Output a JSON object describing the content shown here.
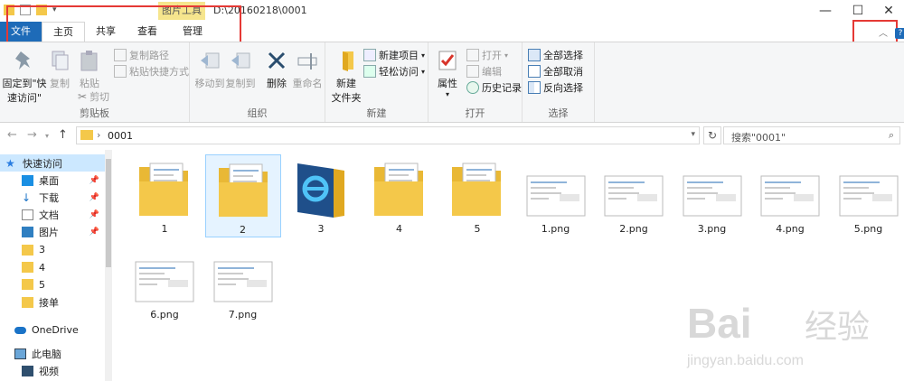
{
  "titlebar": {
    "context_tab": "图片工具",
    "path": "D:\\20160218\\0001",
    "minimize": "—",
    "maximize": "☐",
    "close": "✕"
  },
  "tabs": {
    "file": "文件",
    "home": "主页",
    "share": "共享",
    "view": "查看",
    "manage": "管理"
  },
  "ribbon": {
    "clipboard": {
      "label": "剪贴板",
      "pin_quick_1": "固定到\"快",
      "pin_quick_2": "速访问\"",
      "copy": "复制",
      "paste": "粘贴",
      "copy_path": "复制路径",
      "paste_shortcut": "粘贴快捷方式",
      "cut": "剪切"
    },
    "organize": {
      "label": "组织",
      "move_to": "移动到",
      "copy_to": "复制到",
      "delete": "删除",
      "rename": "重命名"
    },
    "new": {
      "label": "新建",
      "new_folder_1": "新建",
      "new_folder_2": "文件夹",
      "new_item": "新建项目",
      "easy_access": "轻松访问"
    },
    "open": {
      "label": "打开",
      "properties": "属性",
      "open": "打开",
      "edit": "编辑",
      "history": "历史记录"
    },
    "select": {
      "label": "选择",
      "select_all": "全部选择",
      "select_none": "全部取消",
      "invert": "反向选择"
    }
  },
  "address": {
    "path": "0001",
    "search_placeholder": "搜索\"0001\""
  },
  "nav": {
    "quick_access": "快速访问",
    "items": [
      {
        "label": "桌面",
        "pinned": true
      },
      {
        "label": "下载",
        "pinned": true
      },
      {
        "label": "文档",
        "pinned": true
      },
      {
        "label": "图片",
        "pinned": true
      },
      {
        "label": "3",
        "pinned": false
      },
      {
        "label": "4",
        "pinned": false
      },
      {
        "label": "5",
        "pinned": false
      },
      {
        "label": "接单",
        "pinned": false
      }
    ],
    "onedrive": "OneDrive",
    "this_pc": "此电脑",
    "video": "视频",
    "pin_glyph": "📌"
  },
  "files": [
    {
      "name": "1",
      "type": "folder"
    },
    {
      "name": "2",
      "type": "folder"
    },
    {
      "name": "3",
      "type": "folder-ie"
    },
    {
      "name": "4",
      "type": "folder"
    },
    {
      "name": "5",
      "type": "folder"
    },
    {
      "name": "1.png",
      "type": "image"
    },
    {
      "name": "2.png",
      "type": "image"
    },
    {
      "name": "3.png",
      "type": "image"
    },
    {
      "name": "4.png",
      "type": "image"
    },
    {
      "name": "5.png",
      "type": "image"
    },
    {
      "name": "6.png",
      "type": "image"
    },
    {
      "name": "7.png",
      "type": "image"
    }
  ],
  "watermark": {
    "brand": "Bai",
    "brand_cn": "经验",
    "url": "jingyan.baidu.com"
  },
  "colors": {
    "file_tab": "#1e6bb8",
    "context_tab": "#f6e58d",
    "highlight": "#e53935",
    "selection": "#cce8ff",
    "folder": "#f4c84a"
  }
}
